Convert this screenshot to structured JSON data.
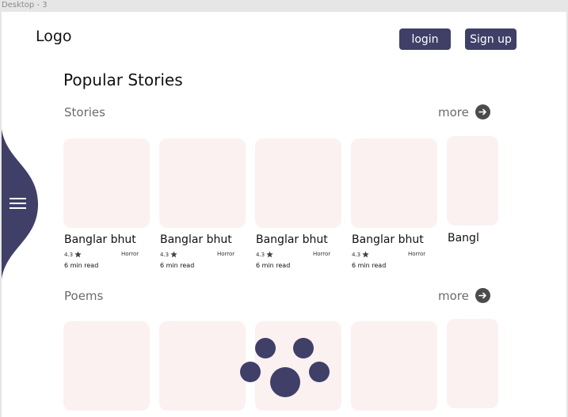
{
  "frame_label": "Desktop - 3",
  "header": {
    "logo": "Logo",
    "login_label": "login",
    "signup_label": "Sign up"
  },
  "page_title": "Popular Stories",
  "sections": {
    "stories": {
      "title": "Stories",
      "more_label": "more",
      "cards": [
        {
          "title": "Banglar bhut",
          "rating": "4.3",
          "genre": "Horror",
          "read_time": "6 min read"
        },
        {
          "title": "Banglar bhut",
          "rating": "4.3",
          "genre": "Horror",
          "read_time": "6 min read"
        },
        {
          "title": "Banglar bhut",
          "rating": "4.3",
          "genre": "Horror",
          "read_time": "6 min read"
        },
        {
          "title": "Banglar bhut",
          "rating": "4.3",
          "genre": "Horror",
          "read_time": "6 min read"
        },
        {
          "title": "Bangl"
        }
      ]
    },
    "poems": {
      "title": "Poems",
      "more_label": "more"
    }
  },
  "colors": {
    "accent": "#3f3f68",
    "card_bg": "#faf1f0",
    "more_arrow": "#4b4b4b"
  },
  "icons": [
    "hamburger-icon",
    "arrow-right-icon",
    "star-icon",
    "paw-icon"
  ]
}
